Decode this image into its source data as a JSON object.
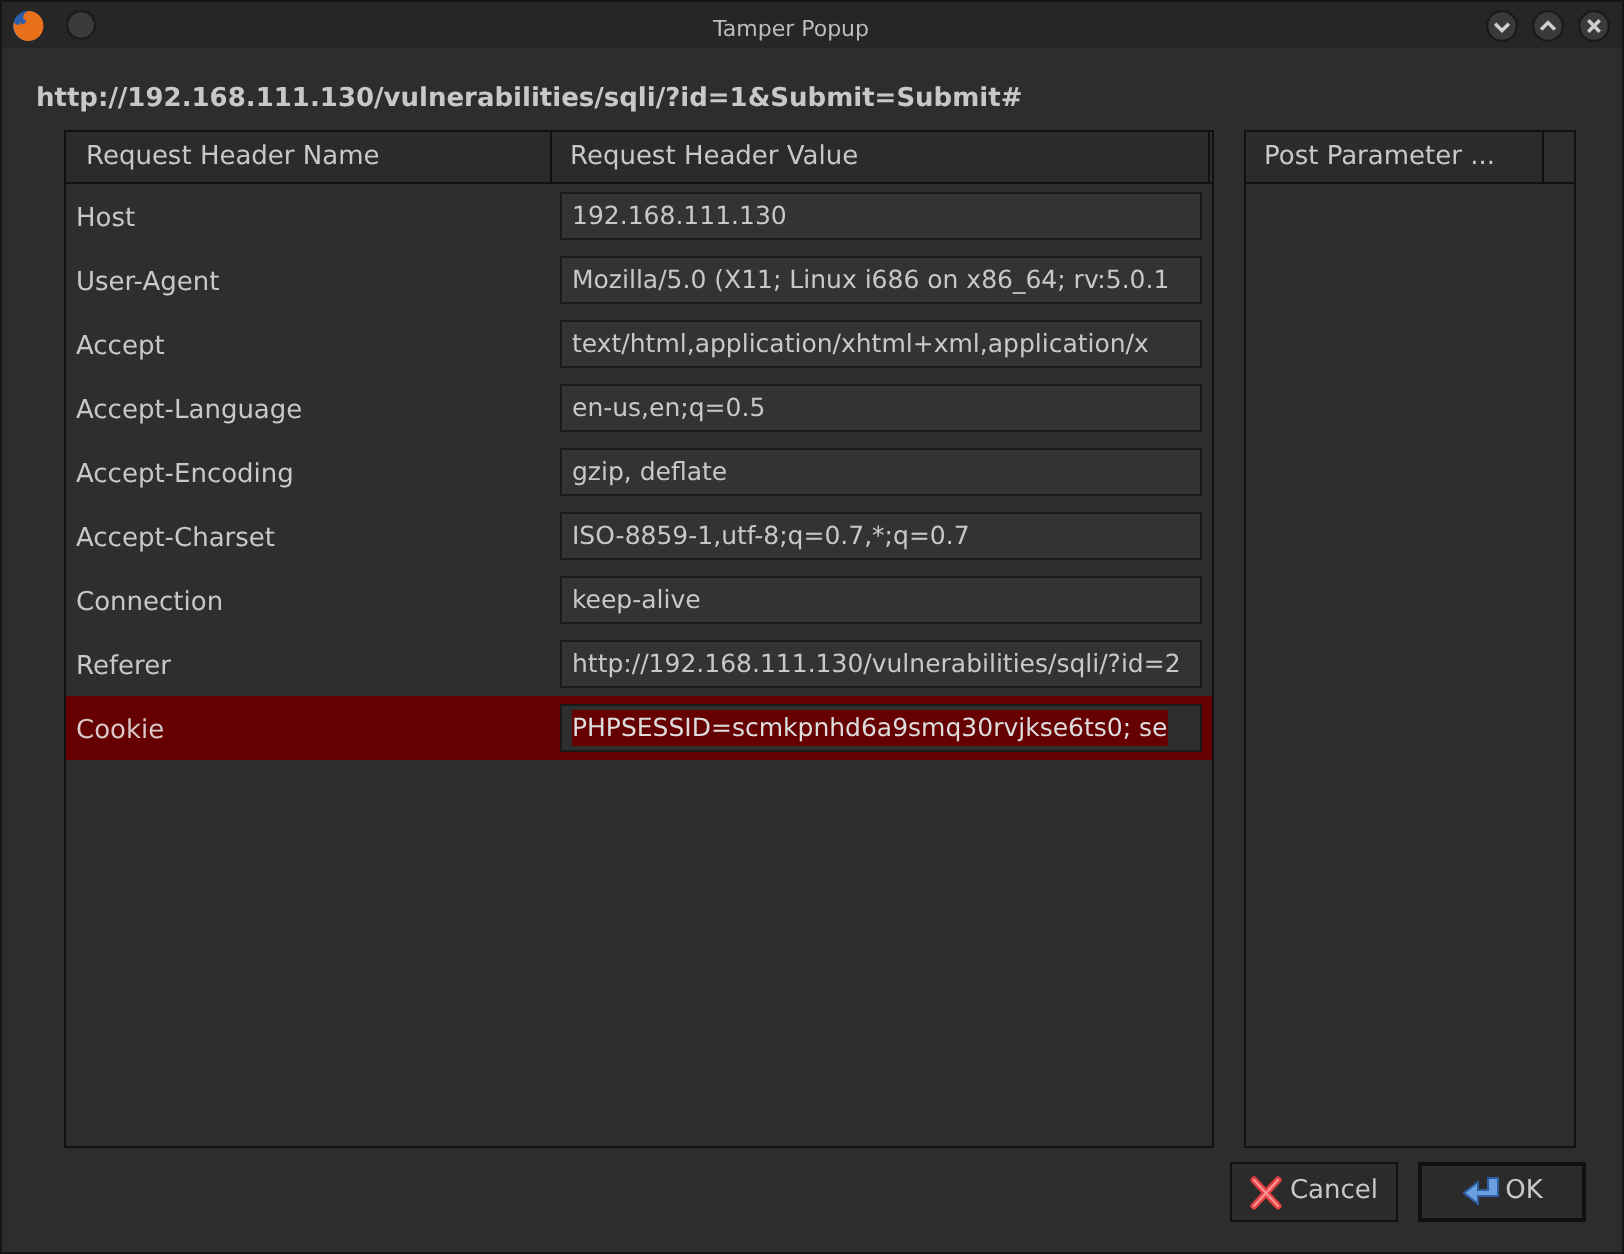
{
  "window": {
    "title": "Tamper Popup"
  },
  "url": "http://192.168.111.130/vulnerabilities/sqli/?id=1&Submit=Submit#",
  "headers_table": {
    "columns": [
      "Request Header Name",
      "Request Header Value"
    ],
    "rows": [
      {
        "name": "Host",
        "value": "192.168.111.130",
        "selected": false
      },
      {
        "name": "User-Agent",
        "value": "Mozilla/5.0 (X11; Linux i686 on x86_64; rv:5.0.1",
        "selected": false
      },
      {
        "name": "Accept",
        "value": "text/html,application/xhtml+xml,application/x",
        "selected": false
      },
      {
        "name": "Accept-Language",
        "value": "en-us,en;q=0.5",
        "selected": false
      },
      {
        "name": "Accept-Encoding",
        "value": "gzip, deflate",
        "selected": false
      },
      {
        "name": "Accept-Charset",
        "value": "ISO-8859-1,utf-8;q=0.7,*;q=0.7",
        "selected": false
      },
      {
        "name": "Connection",
        "value": "keep-alive",
        "selected": false
      },
      {
        "name": "Referer",
        "value": "http://192.168.111.130/vulnerabilities/sqli/?id=2",
        "selected": false
      },
      {
        "name": "Cookie",
        "value": "PHPSESSID=scmkpnhd6a9smq30rvjkse6ts0; se",
        "selected": true
      }
    ]
  },
  "post_table": {
    "columns": [
      "Post Parameter ..."
    ]
  },
  "buttons": [
    {
      "label": "Cancel",
      "kind": "cancel"
    },
    {
      "label": "OK",
      "kind": "ok"
    }
  ]
}
